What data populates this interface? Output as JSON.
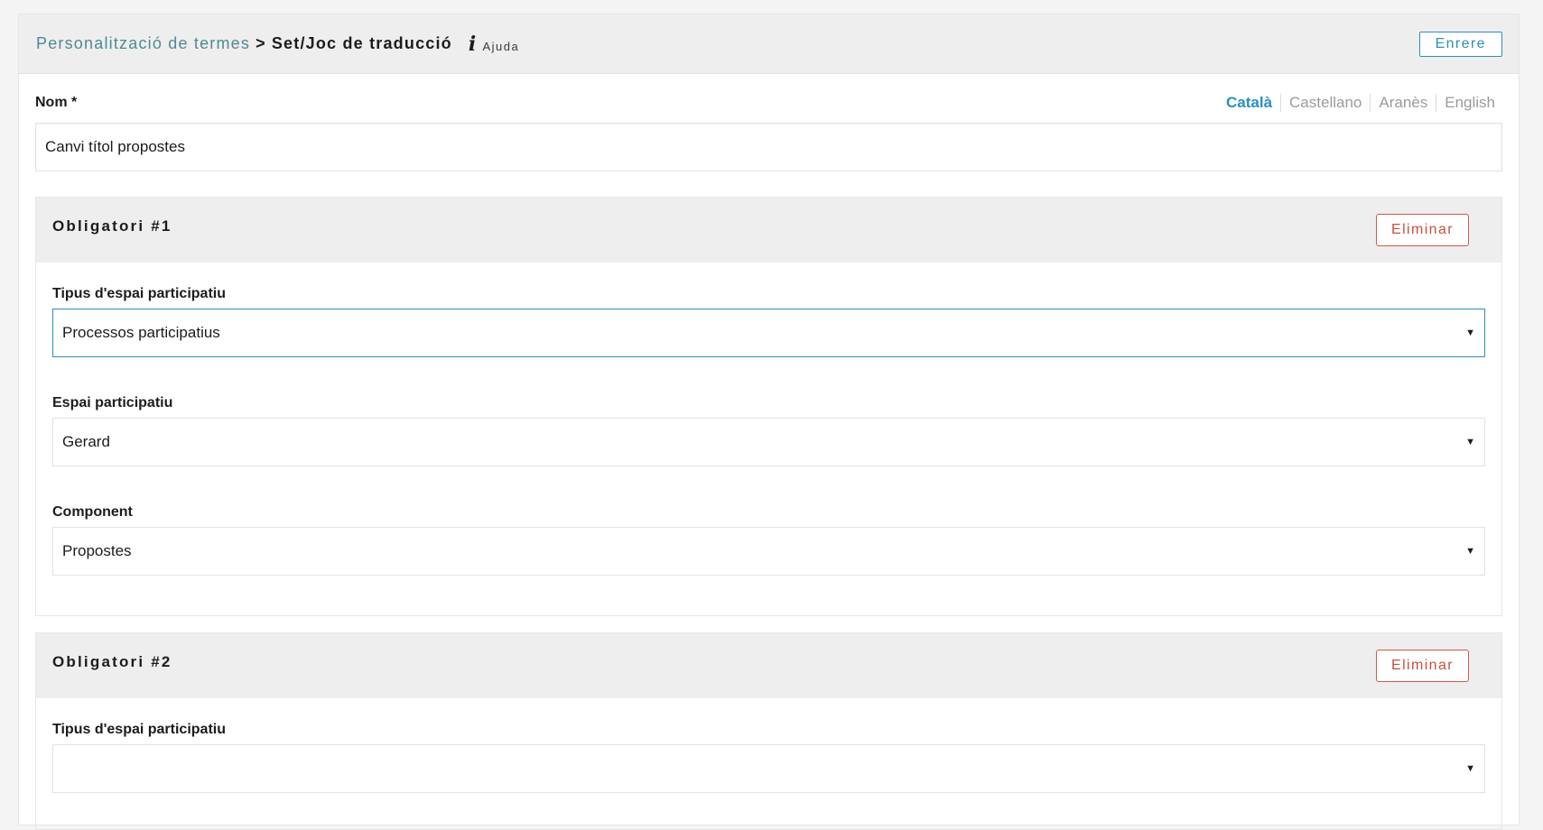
{
  "header": {
    "breadcrumb_parent": "Personalització de termes",
    "breadcrumb_separator": ">",
    "breadcrumb_current": "Set/Joc de traducció",
    "help_label": "Ajuda",
    "back_label": "Enrere"
  },
  "name_field": {
    "label": "Nom *",
    "value": "Canvi títol propostes",
    "languages": [
      "Català",
      "Castellano",
      "Aranès",
      "English"
    ],
    "active_language": "Català"
  },
  "sections": [
    {
      "title": "Obligatori #1",
      "delete_label": "Eliminar",
      "fields": [
        {
          "label": "Tipus d'espai participatiu",
          "value": "Processos participatius"
        },
        {
          "label": "Espai participatiu",
          "value": "Gerard"
        },
        {
          "label": "Component",
          "value": "Propostes"
        }
      ]
    },
    {
      "title": "Obligatori #2",
      "delete_label": "Eliminar",
      "fields": [
        {
          "label": "Tipus d'espai participatiu",
          "value": ""
        }
      ]
    }
  ],
  "colors": {
    "accent_blue": "#2a8fc1",
    "link_teal": "#4e8a94",
    "danger_red": "#c9503e",
    "header_bg": "#eeeeee"
  },
  "icons": {
    "help": "info-italic-i-icon",
    "select_caret": "caret-down-icon"
  }
}
